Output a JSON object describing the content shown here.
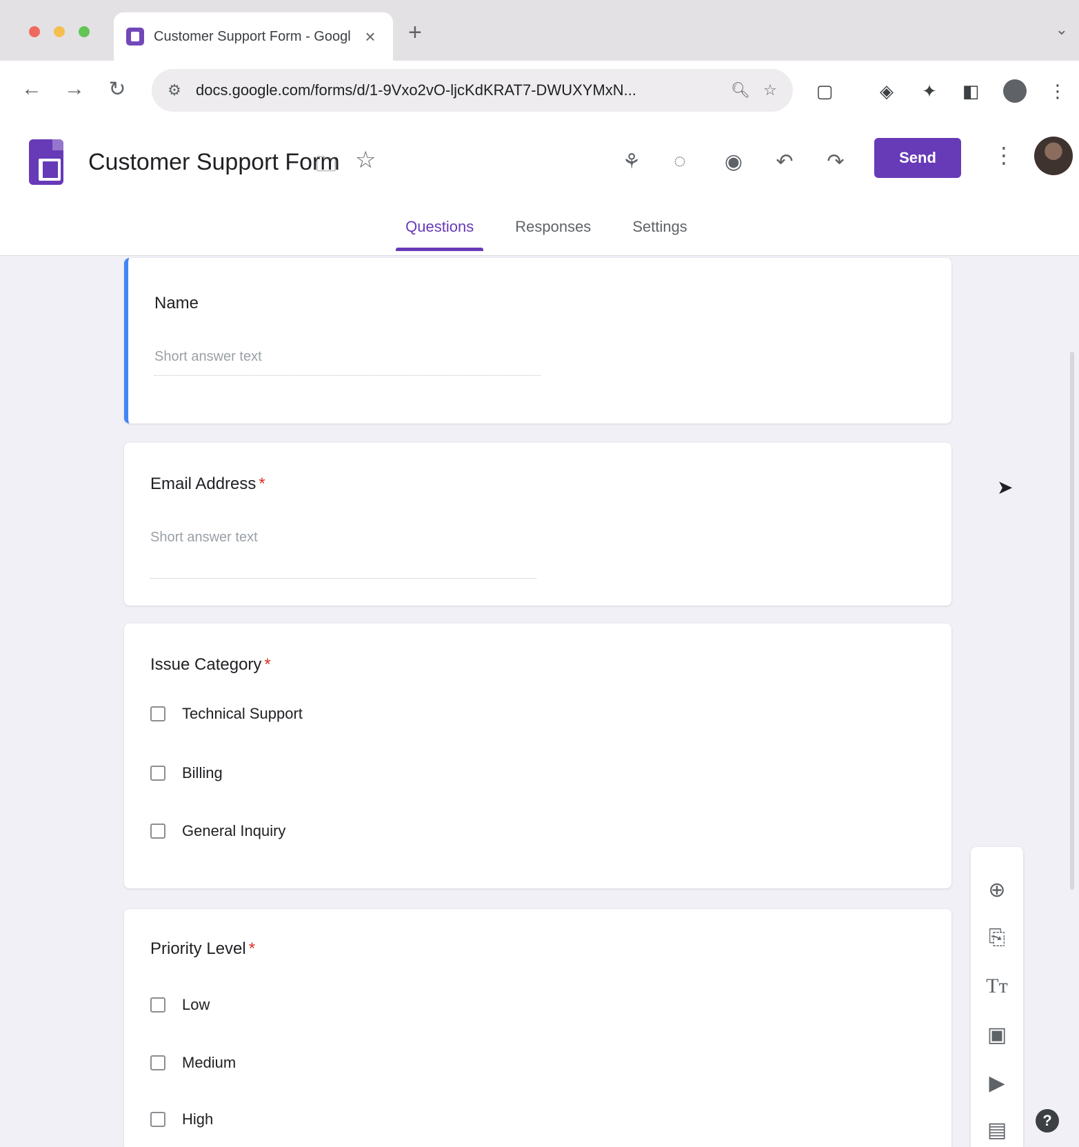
{
  "browser": {
    "tab": {
      "title": "Customer Support Form - Google Forms",
      "close_glyph": "×"
    },
    "new_tab_glyph": "+",
    "url": "docs.google.com/forms/d/1-9Vxo2vO-ljcKdKRAT7-DWUXYMxN...",
    "nav": {
      "back": "←",
      "forward": "→",
      "reload": "↻"
    }
  },
  "header": {
    "form_title": "Customer Support Form",
    "send_label": "Send",
    "tabs": [
      {
        "label": "Questions",
        "active": true
      },
      {
        "label": "Responses",
        "active": false
      },
      {
        "label": "Settings",
        "active": false
      }
    ]
  },
  "questions": [
    {
      "title": "Name",
      "required": false,
      "type": "short",
      "placeholder": "Short answer text"
    },
    {
      "title": "Email Address",
      "required": true,
      "type": "short",
      "placeholder": "Short answer text"
    },
    {
      "title": "Issue Category",
      "required": true,
      "type": "checkbox",
      "options": [
        "Technical Support",
        "Billing",
        "General Inquiry"
      ]
    },
    {
      "title": "Priority Level",
      "required": true,
      "type": "checkbox",
      "options": [
        "Low",
        "Medium",
        "High"
      ]
    }
  ],
  "required_mark": "*",
  "colors": {
    "accent": "#673ab7",
    "active_card_border": "#4285f4",
    "background": "#f1f0f7"
  },
  "icons": {
    "side_toolbar": [
      "add-question-icon",
      "import-questions-icon",
      "add-title-icon",
      "add-image-icon",
      "add-video-icon",
      "add-section-icon"
    ]
  }
}
